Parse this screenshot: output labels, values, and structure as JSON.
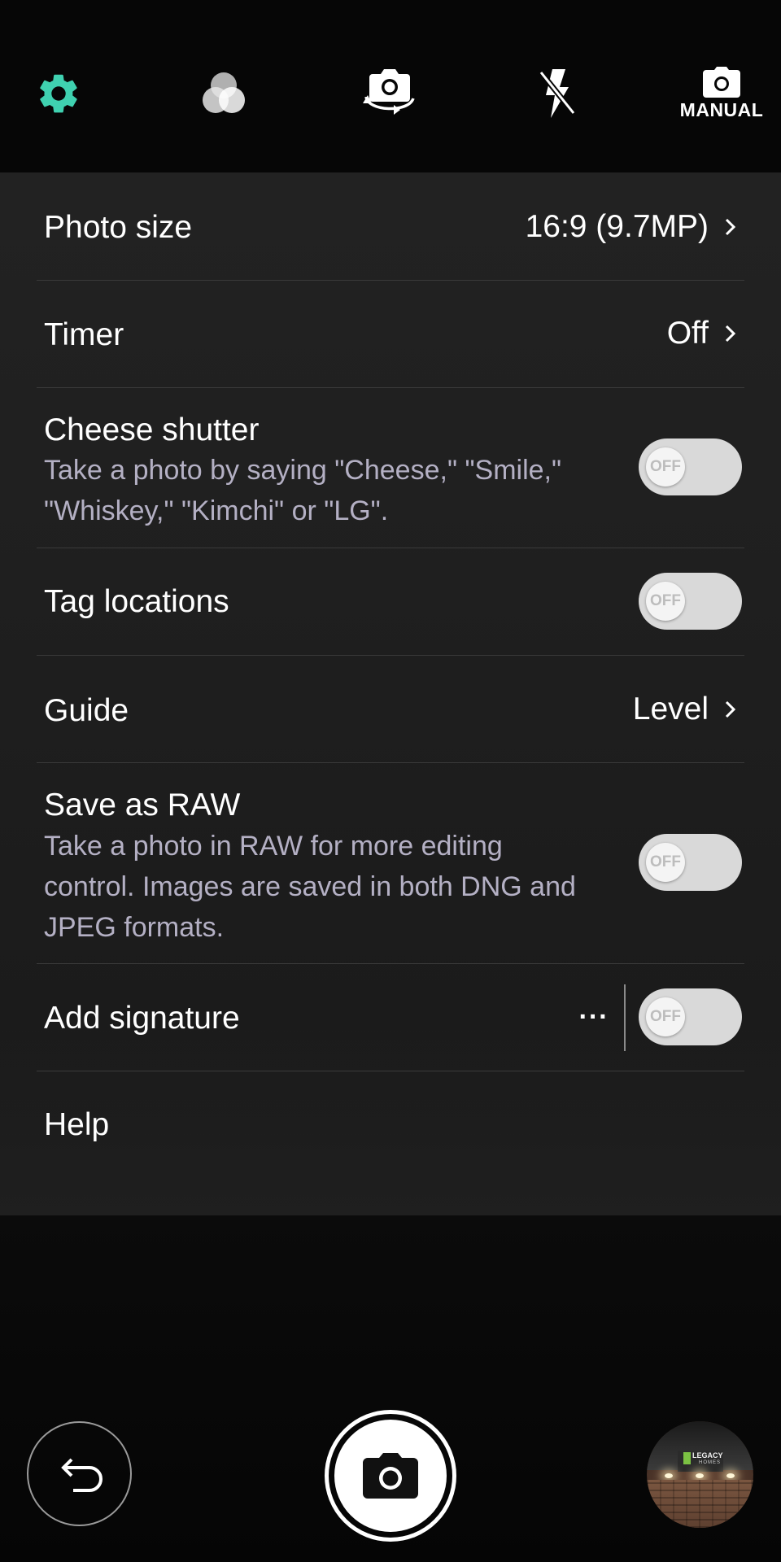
{
  "toolbar": {
    "manual_label": "MANUAL",
    "accent_color": "#3fd1b0"
  },
  "settings": {
    "photo_size": {
      "title": "Photo size",
      "value": "16:9 (9.7MP)"
    },
    "timer": {
      "title": "Timer",
      "value": "Off"
    },
    "cheese_shutter": {
      "title": "Cheese shutter",
      "description": "Take a photo by saying \"Cheese,\" \"Smile,\" \"Whiskey,\" \"Kimchi\" or \"LG\".",
      "toggle": "OFF"
    },
    "tag_locations": {
      "title": "Tag locations",
      "toggle": "OFF"
    },
    "guide": {
      "title": "Guide",
      "value": "Level"
    },
    "save_as_raw": {
      "title": "Save as RAW",
      "description": "Take a photo in RAW for more editing control. Images are saved in both DNG and JPEG formats.",
      "toggle": "OFF"
    },
    "add_signature": {
      "title": "Add signature",
      "more": "···",
      "toggle": "OFF"
    },
    "help": {
      "title": "Help"
    }
  },
  "gallery_thumbnail": {
    "sign_text": "LEGACY",
    "sign_subtext": "HOMES"
  }
}
